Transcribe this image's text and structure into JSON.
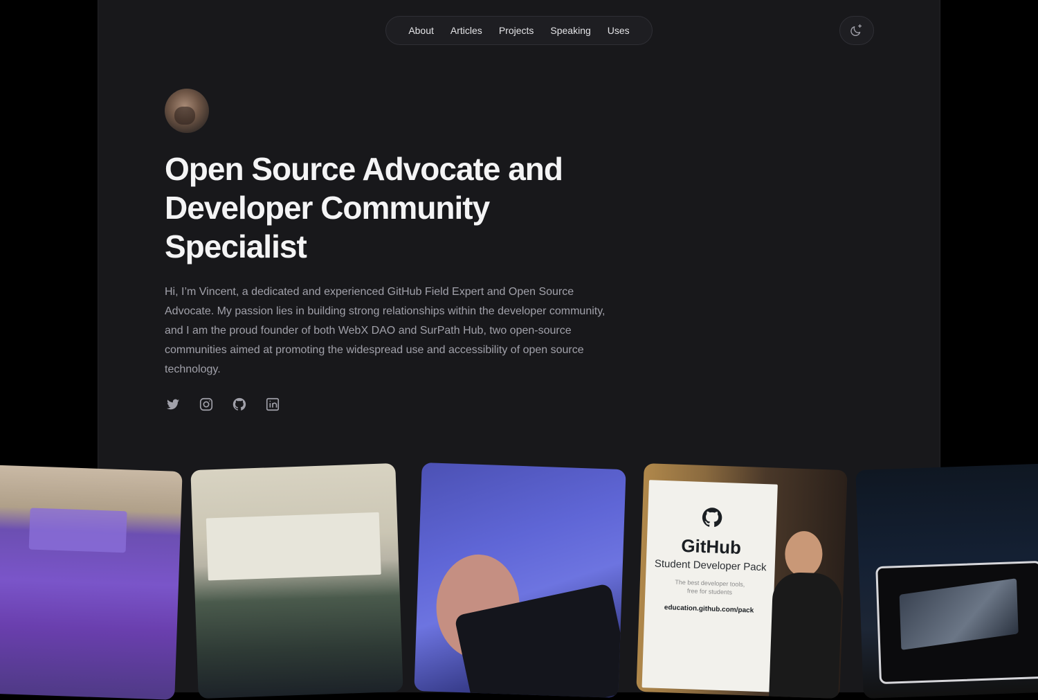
{
  "nav": {
    "items": [
      {
        "label": "About"
      },
      {
        "label": "Articles"
      },
      {
        "label": "Projects"
      },
      {
        "label": "Speaking"
      },
      {
        "label": "Uses"
      }
    ]
  },
  "theme_toggle": {
    "icon": "moon-sparkle-icon"
  },
  "hero": {
    "headline": "Open Source Advocate and Developer Community Specialist",
    "intro": "Hi, I’m Vincent, a dedicated and experienced GitHub Field Expert and Open Source Advocate. My passion lies in building strong relationships within the developer community, and I am the proud founder of both WebX DAO and SurPath Hub, two open-source communities aimed at promoting the widespread use and accessibility of open source technology."
  },
  "socials": [
    {
      "icon": "twitter-icon"
    },
    {
      "icon": "instagram-icon"
    },
    {
      "icon": "github-icon"
    },
    {
      "icon": "linkedin-icon"
    }
  ],
  "photos": {
    "poster": {
      "title": "GitHub",
      "subtitle": "Student Developer Pack",
      "tagline_1": "The best developer tools,",
      "tagline_2": "free for students",
      "url": "education.github.com/pack"
    }
  },
  "colors": {
    "background": "#18181b",
    "outer": "#000000",
    "text_primary": "#f4f4f5",
    "text_secondary": "#a1a1aa"
  }
}
